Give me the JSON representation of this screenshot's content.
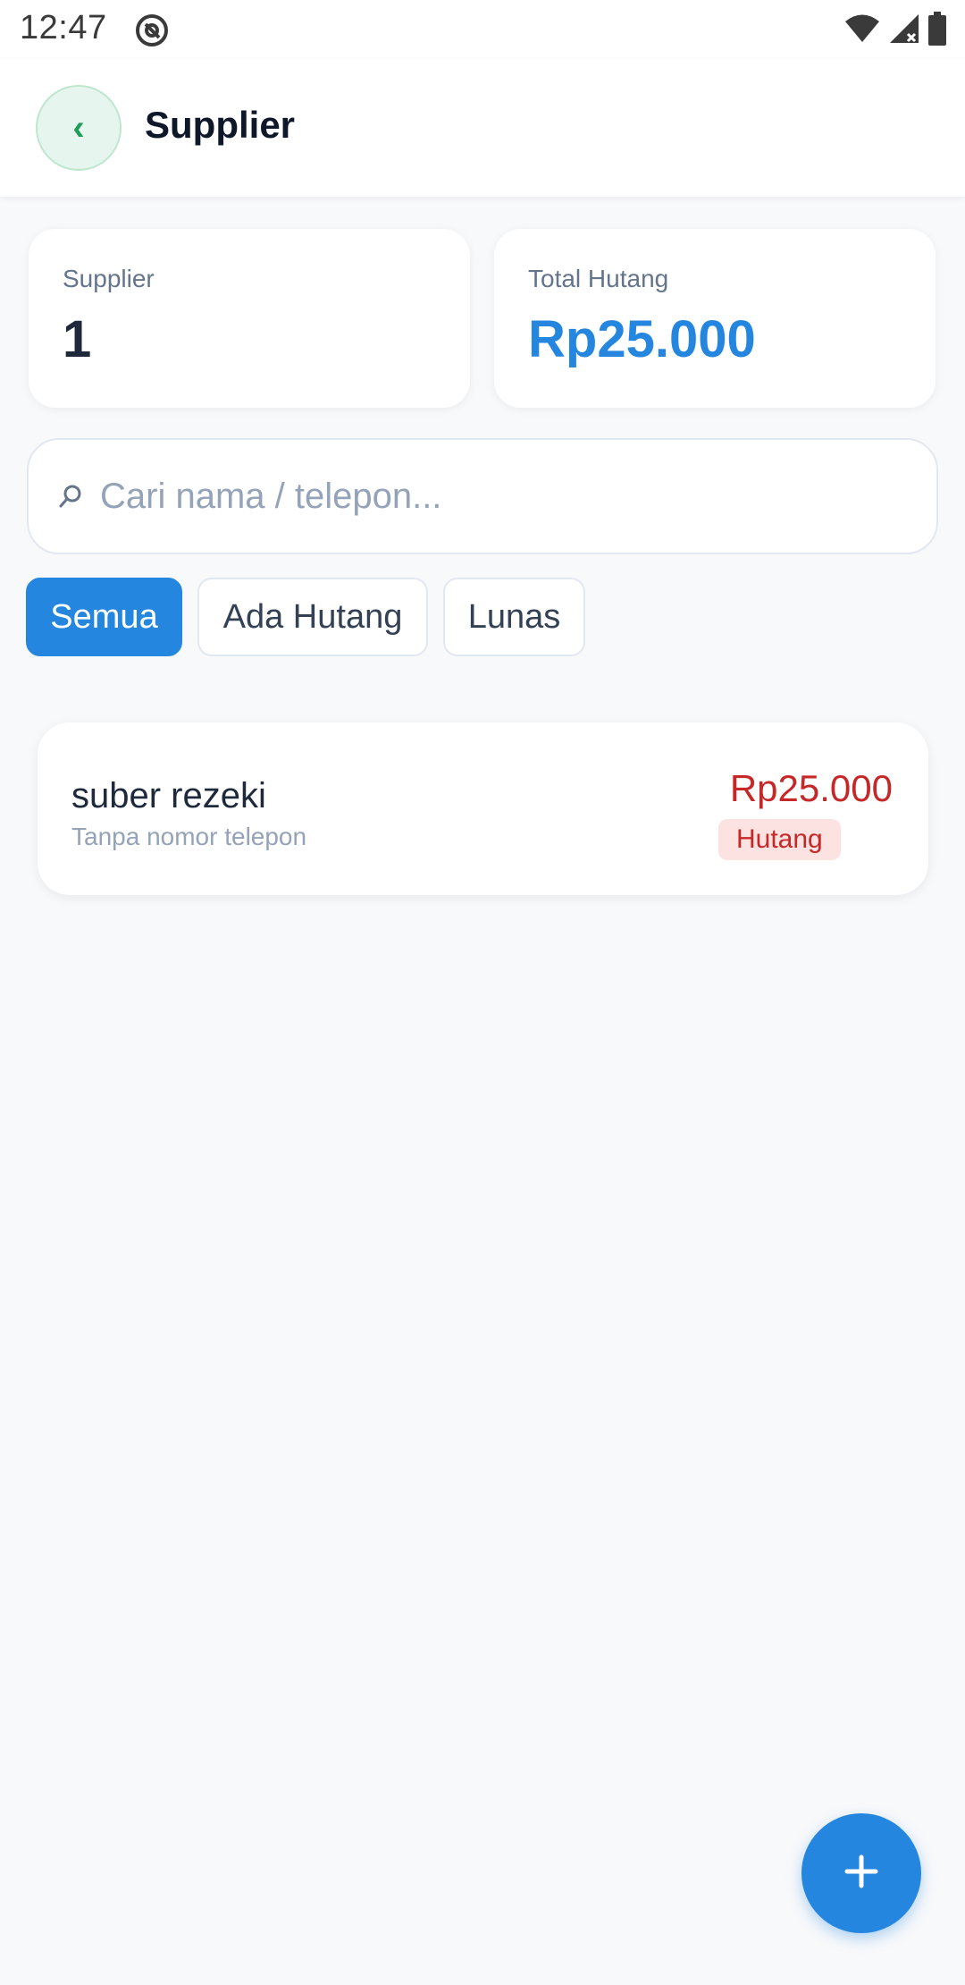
{
  "status_bar": {
    "time": "12:47"
  },
  "app_bar": {
    "back_glyph": "‹",
    "title": "Supplier"
  },
  "stats": {
    "supplier_label": "Supplier",
    "supplier_count": "1",
    "total_debt_label": "Total Hutang",
    "total_debt_value": "Rp25.000"
  },
  "search": {
    "placeholder": "Cari nama / telepon...",
    "value": ""
  },
  "filters": [
    {
      "label": "Semua",
      "active": true
    },
    {
      "label": "Ada Hutang",
      "active": false
    },
    {
      "label": "Lunas",
      "active": false
    }
  ],
  "suppliers": [
    {
      "name": "suber rezeki",
      "phone": "Tanpa nomor telepon",
      "amount": "Rp25.000",
      "status": "Hutang"
    }
  ],
  "colors": {
    "accent": "#2586e0",
    "debt_red": "#c62828",
    "badge_bg": "#fde2e2",
    "back_bg": "#e6f6ee"
  },
  "icons": [
    "at-sign-icon",
    "wifi-icon",
    "signal-icon",
    "battery-icon",
    "back-chevron-icon",
    "search-icon",
    "plus-icon"
  ]
}
